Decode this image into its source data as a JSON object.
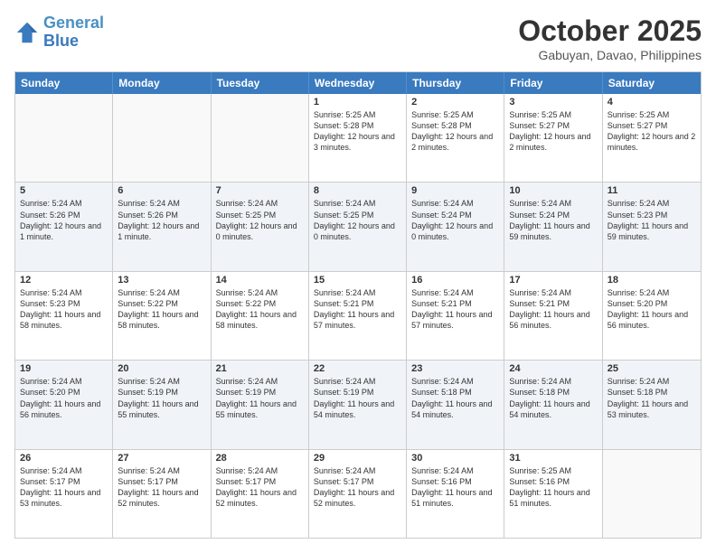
{
  "logo": {
    "line1": "General",
    "line2": "Blue"
  },
  "title": "October 2025",
  "subtitle": "Gabuyan, Davao, Philippines",
  "dayHeaders": [
    "Sunday",
    "Monday",
    "Tuesday",
    "Wednesday",
    "Thursday",
    "Friday",
    "Saturday"
  ],
  "rows": [
    [
      {
        "num": "",
        "info": ""
      },
      {
        "num": "",
        "info": ""
      },
      {
        "num": "",
        "info": ""
      },
      {
        "num": "1",
        "info": "Sunrise: 5:25 AM\nSunset: 5:28 PM\nDaylight: 12 hours and 3 minutes."
      },
      {
        "num": "2",
        "info": "Sunrise: 5:25 AM\nSunset: 5:28 PM\nDaylight: 12 hours and 2 minutes."
      },
      {
        "num": "3",
        "info": "Sunrise: 5:25 AM\nSunset: 5:27 PM\nDaylight: 12 hours and 2 minutes."
      },
      {
        "num": "4",
        "info": "Sunrise: 5:25 AM\nSunset: 5:27 PM\nDaylight: 12 hours and 2 minutes."
      }
    ],
    [
      {
        "num": "5",
        "info": "Sunrise: 5:24 AM\nSunset: 5:26 PM\nDaylight: 12 hours and 1 minute."
      },
      {
        "num": "6",
        "info": "Sunrise: 5:24 AM\nSunset: 5:26 PM\nDaylight: 12 hours and 1 minute."
      },
      {
        "num": "7",
        "info": "Sunrise: 5:24 AM\nSunset: 5:25 PM\nDaylight: 12 hours and 0 minutes."
      },
      {
        "num": "8",
        "info": "Sunrise: 5:24 AM\nSunset: 5:25 PM\nDaylight: 12 hours and 0 minutes."
      },
      {
        "num": "9",
        "info": "Sunrise: 5:24 AM\nSunset: 5:24 PM\nDaylight: 12 hours and 0 minutes."
      },
      {
        "num": "10",
        "info": "Sunrise: 5:24 AM\nSunset: 5:24 PM\nDaylight: 11 hours and 59 minutes."
      },
      {
        "num": "11",
        "info": "Sunrise: 5:24 AM\nSunset: 5:23 PM\nDaylight: 11 hours and 59 minutes."
      }
    ],
    [
      {
        "num": "12",
        "info": "Sunrise: 5:24 AM\nSunset: 5:23 PM\nDaylight: 11 hours and 58 minutes."
      },
      {
        "num": "13",
        "info": "Sunrise: 5:24 AM\nSunset: 5:22 PM\nDaylight: 11 hours and 58 minutes."
      },
      {
        "num": "14",
        "info": "Sunrise: 5:24 AM\nSunset: 5:22 PM\nDaylight: 11 hours and 58 minutes."
      },
      {
        "num": "15",
        "info": "Sunrise: 5:24 AM\nSunset: 5:21 PM\nDaylight: 11 hours and 57 minutes."
      },
      {
        "num": "16",
        "info": "Sunrise: 5:24 AM\nSunset: 5:21 PM\nDaylight: 11 hours and 57 minutes."
      },
      {
        "num": "17",
        "info": "Sunrise: 5:24 AM\nSunset: 5:21 PM\nDaylight: 11 hours and 56 minutes."
      },
      {
        "num": "18",
        "info": "Sunrise: 5:24 AM\nSunset: 5:20 PM\nDaylight: 11 hours and 56 minutes."
      }
    ],
    [
      {
        "num": "19",
        "info": "Sunrise: 5:24 AM\nSunset: 5:20 PM\nDaylight: 11 hours and 56 minutes."
      },
      {
        "num": "20",
        "info": "Sunrise: 5:24 AM\nSunset: 5:19 PM\nDaylight: 11 hours and 55 minutes."
      },
      {
        "num": "21",
        "info": "Sunrise: 5:24 AM\nSunset: 5:19 PM\nDaylight: 11 hours and 55 minutes."
      },
      {
        "num": "22",
        "info": "Sunrise: 5:24 AM\nSunset: 5:19 PM\nDaylight: 11 hours and 54 minutes."
      },
      {
        "num": "23",
        "info": "Sunrise: 5:24 AM\nSunset: 5:18 PM\nDaylight: 11 hours and 54 minutes."
      },
      {
        "num": "24",
        "info": "Sunrise: 5:24 AM\nSunset: 5:18 PM\nDaylight: 11 hours and 54 minutes."
      },
      {
        "num": "25",
        "info": "Sunrise: 5:24 AM\nSunset: 5:18 PM\nDaylight: 11 hours and 53 minutes."
      }
    ],
    [
      {
        "num": "26",
        "info": "Sunrise: 5:24 AM\nSunset: 5:17 PM\nDaylight: 11 hours and 53 minutes."
      },
      {
        "num": "27",
        "info": "Sunrise: 5:24 AM\nSunset: 5:17 PM\nDaylight: 11 hours and 52 minutes."
      },
      {
        "num": "28",
        "info": "Sunrise: 5:24 AM\nSunset: 5:17 PM\nDaylight: 11 hours and 52 minutes."
      },
      {
        "num": "29",
        "info": "Sunrise: 5:24 AM\nSunset: 5:17 PM\nDaylight: 11 hours and 52 minutes."
      },
      {
        "num": "30",
        "info": "Sunrise: 5:24 AM\nSunset: 5:16 PM\nDaylight: 11 hours and 51 minutes."
      },
      {
        "num": "31",
        "info": "Sunrise: 5:25 AM\nSunset: 5:16 PM\nDaylight: 11 hours and 51 minutes."
      },
      {
        "num": "",
        "info": ""
      }
    ]
  ]
}
